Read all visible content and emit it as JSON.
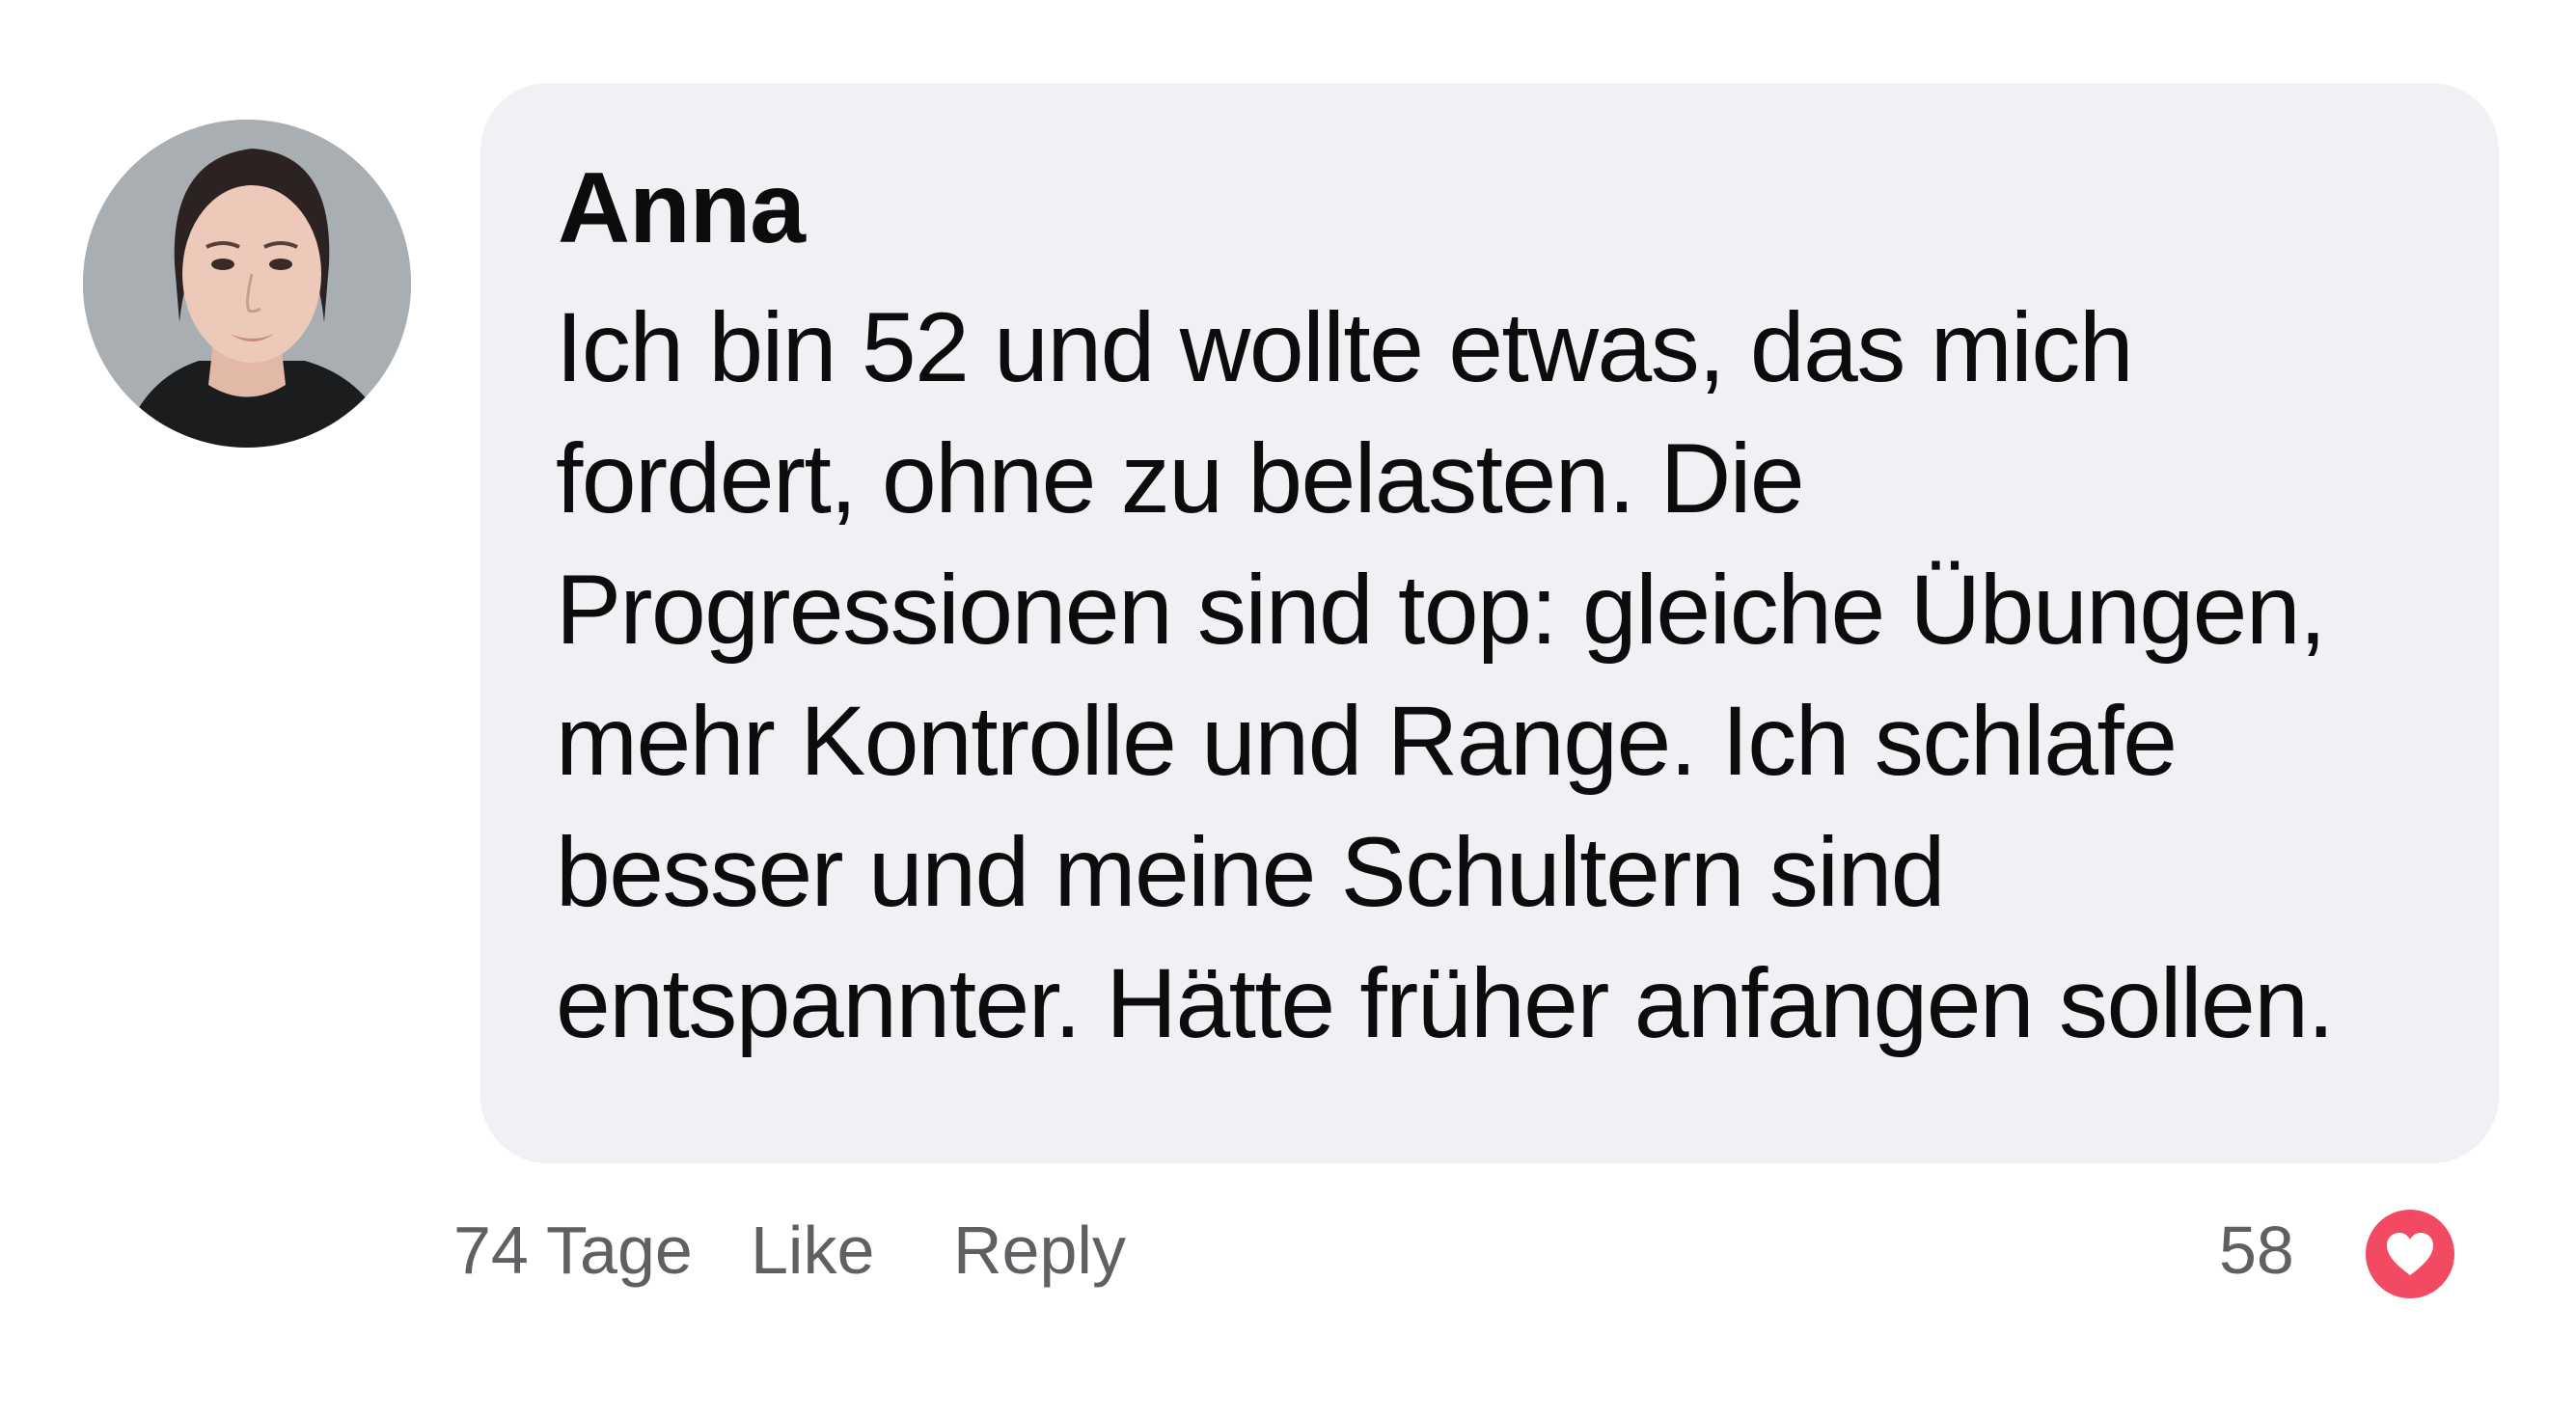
{
  "comment": {
    "author": "Anna",
    "text_lines": [
      "Ich bin 52 und wollte etwas, das mich",
      "fordert, ohne zu belasten. Die",
      "Progressionen sind top: gleiche Übungen,",
      "mehr Kontrolle und Range. Ich schlafe",
      "besser und meine Schultern sind",
      "entspannter. Hätte früher anfangen sollen."
    ],
    "avatar_icon": "user-avatar-photo",
    "bubble_color": "#f0f1f5"
  },
  "actions": {
    "time": "74 Tage",
    "like_label": "Like",
    "reply_label": "Reply",
    "like_count": "58",
    "heart_icon": "heart-icon",
    "heart_color": "#f24a63"
  }
}
